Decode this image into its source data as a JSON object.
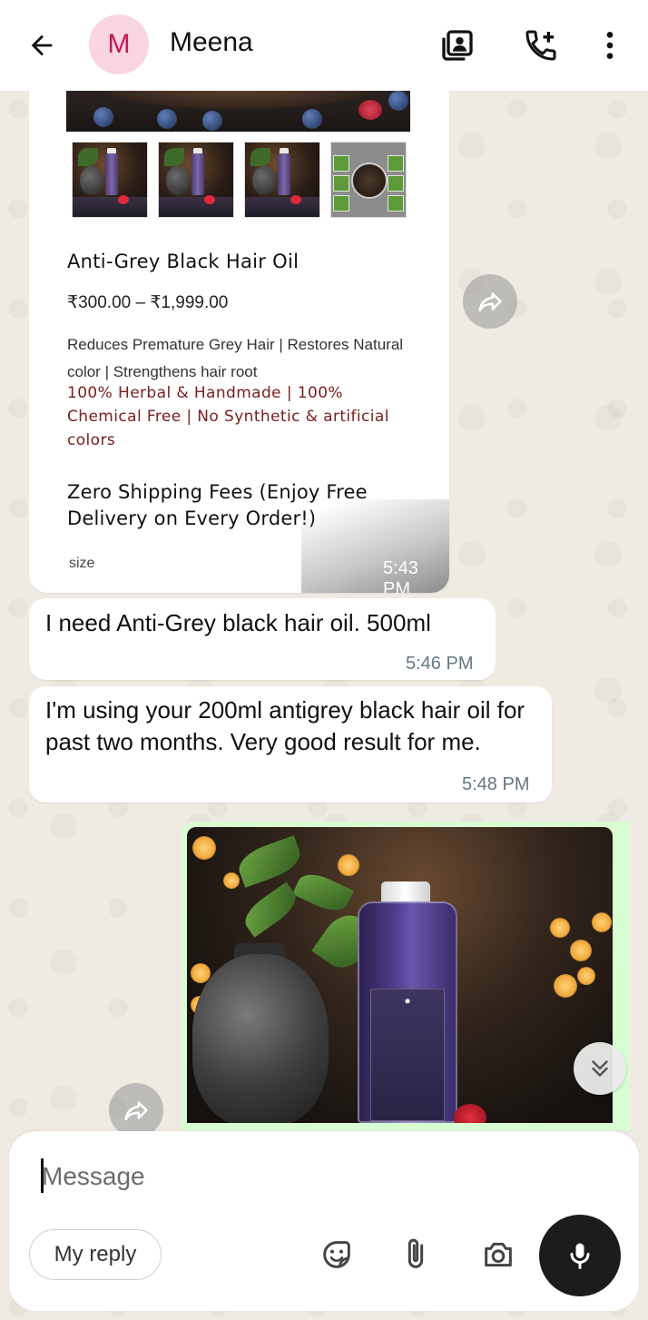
{
  "header": {
    "avatar_letter": "M",
    "contact_name": "Meena"
  },
  "link_preview": {
    "title": "Anti-Grey Black Hair Oil",
    "price": "₹300.00 – ₹1,999.00",
    "description": "Reduces Premature Grey Hair | Restores Natural color | Strengthens hair root",
    "highlight": "100% Herbal & Handmade | 100% Chemical Free | No Synthetic & artificial colors",
    "shipping": "Zero Shipping Fees (Enjoy Free Delivery on Every Order!)",
    "size_label": "size",
    "time": "5:43 PM"
  },
  "messages": [
    {
      "text": "I need Anti-Grey black hair oil. 500ml",
      "time": "5:46 PM"
    },
    {
      "text": "I'm using your 200ml antigrey black hair oil for past two months. Very good result for me.",
      "time": "5:48 PM"
    }
  ],
  "composer": {
    "placeholder": "Message",
    "my_reply_label": "My reply"
  },
  "colors": {
    "header_bg": "#ffffff",
    "chat_bg": "#efeae2",
    "outgoing_bubble": "#d9fdd3",
    "avatar_bg": "#f9d5df",
    "avatar_fg": "#c2185b",
    "highlight_text": "#7a1d1d",
    "mic_button": "#1c1c1c"
  },
  "icons": {
    "back": "arrow-left-icon",
    "contact_card": "contact-card-icon",
    "add_call": "add-call-icon",
    "menu": "more-vertical-icon",
    "forward": "forward-icon",
    "scroll_down": "double-chevron-down-icon",
    "sticker": "sticker-icon",
    "attach": "paperclip-icon",
    "camera": "camera-icon",
    "mic": "mic-icon"
  }
}
